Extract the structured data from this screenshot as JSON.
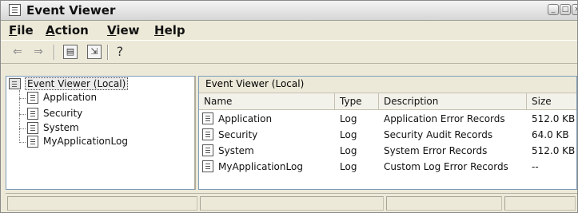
{
  "window": {
    "title": "Event Viewer"
  },
  "menu": [
    {
      "mnemonic": "F",
      "rest": "ile"
    },
    {
      "mnemonic": "A",
      "rest": "ction"
    },
    {
      "mnemonic": "V",
      "rest": "iew"
    },
    {
      "mnemonic": "H",
      "rest": "elp"
    }
  ],
  "toolbar": {
    "icons": [
      "back-arrow-icon",
      "forward-arrow-icon",
      "show-hide-tree-icon",
      "export-list-icon",
      "help-icon"
    ]
  },
  "tree": {
    "root": "Event Viewer (Local)",
    "items": [
      "Application",
      "Security",
      "System",
      "MyApplicationLog"
    ]
  },
  "list": {
    "header": "Event Viewer (Local)",
    "columns": [
      "Name",
      "Type",
      "Description",
      "Size"
    ],
    "rows": [
      {
        "name": "Application",
        "type": "Log",
        "description": "Application Error Records",
        "size": "512.0 KB"
      },
      {
        "name": "Security",
        "type": "Log",
        "description": "Security Audit Records",
        "size": "64.0 KB"
      },
      {
        "name": "System",
        "type": "Log",
        "description": "System Error Records",
        "size": "512.0 KB"
      },
      {
        "name": "MyApplicationLog",
        "type": "Log",
        "description": "Custom Log Error Records",
        "size": "--"
      }
    ]
  }
}
